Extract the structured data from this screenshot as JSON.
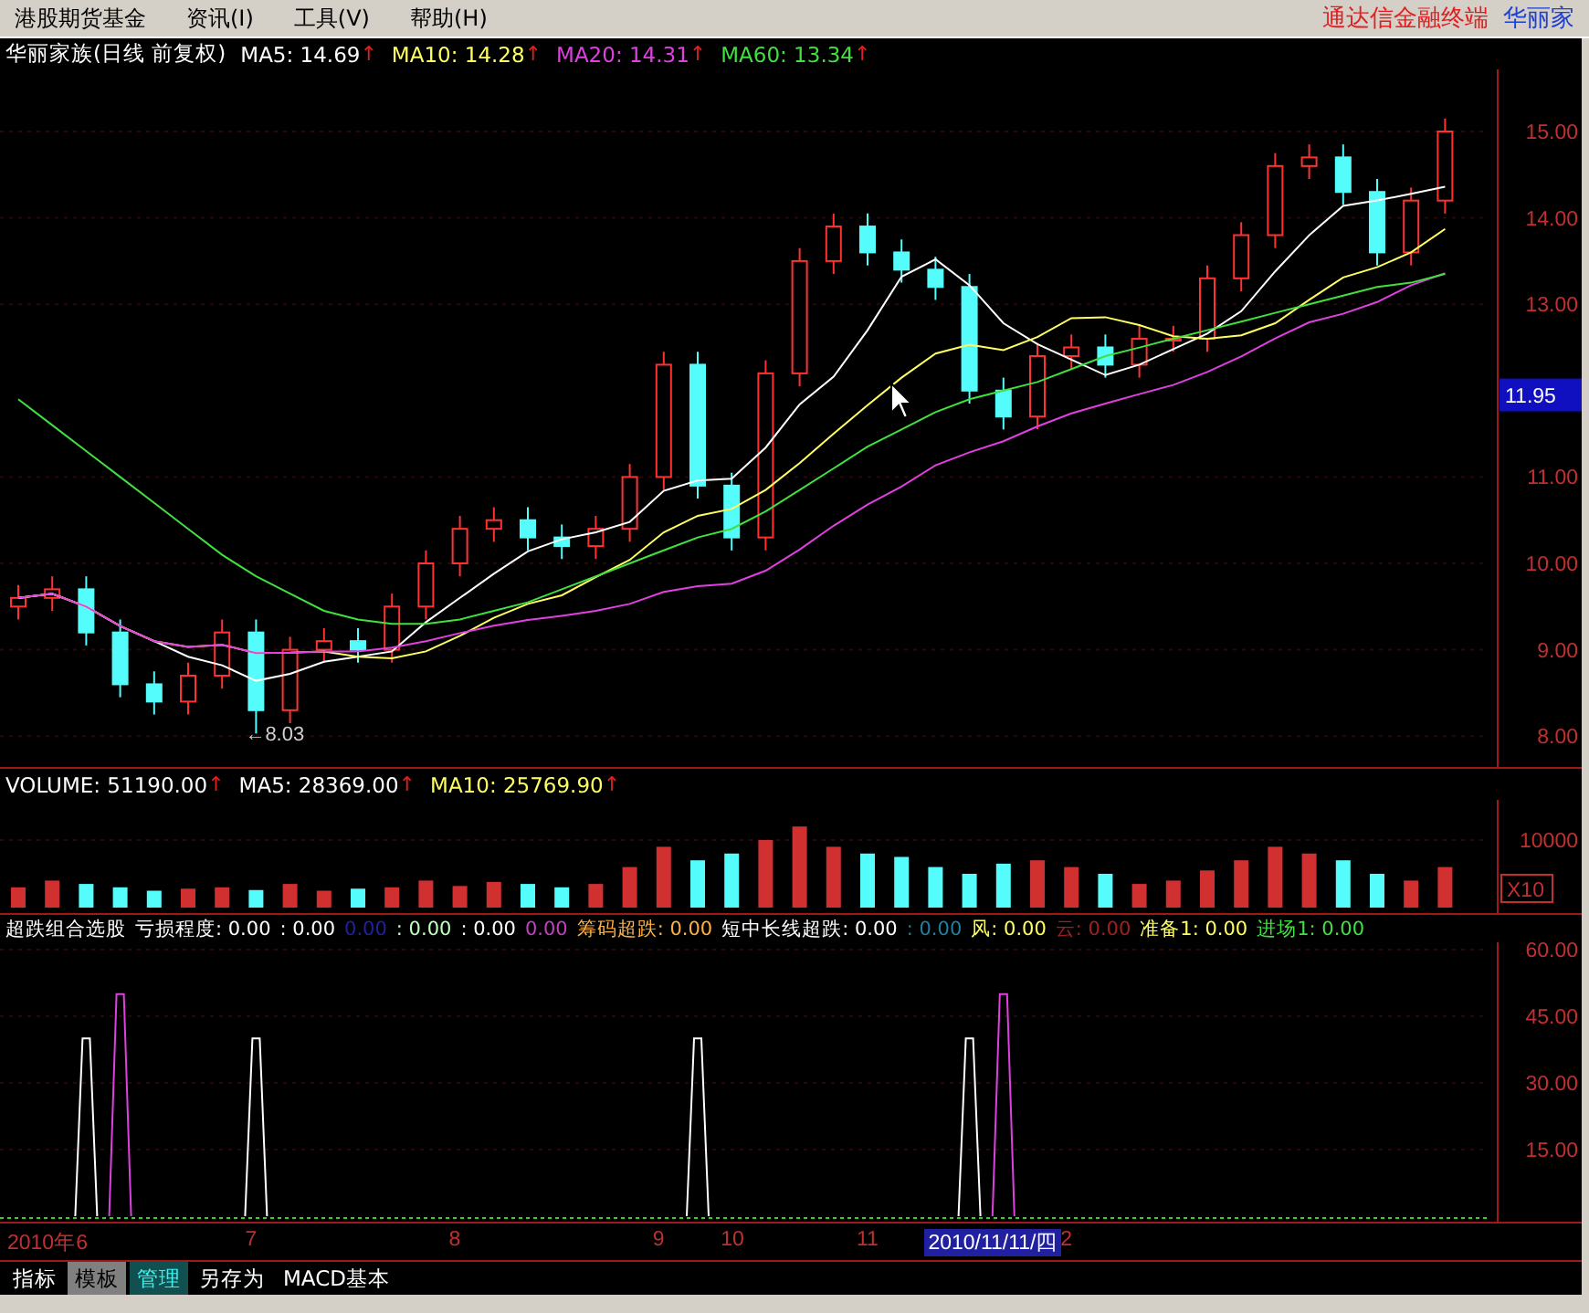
{
  "menu_bar": {
    "items": [
      "港股期货基金",
      "资讯(I)",
      "工具(V)",
      "帮助(H)"
    ],
    "title_parts": [
      {
        "text": "通达信金融终端",
        "color": "#e02020"
      },
      {
        "text": "华丽家",
        "color": "#2040d0"
      }
    ]
  },
  "price_panel": {
    "legend": [
      {
        "text": "华丽家族(日线 前复权)",
        "color": "#ffffff"
      },
      {
        "text": "MA5: 14.69",
        "color": "#ffffff",
        "arrow": "↑"
      },
      {
        "text": "MA10: 14.28",
        "color": "#ffff60",
        "arrow": "↑"
      },
      {
        "text": "MA20: 14.31",
        "color": "#e040e0",
        "arrow": "↑"
      },
      {
        "text": "MA60: 13.34",
        "color": "#40e040",
        "arrow": "↑"
      }
    ],
    "axis_labels": [
      "15.00",
      "14.00",
      "13.00",
      "11.00",
      "10.00",
      "9.00",
      "8.00"
    ],
    "cursor_price": "11.95",
    "low_label": "←8.03"
  },
  "volume_panel": {
    "legend": [
      {
        "text": "VOLUME: 51190.00",
        "color": "#ffffff",
        "arrow": "↑"
      },
      {
        "text": "MA5: 28369.00",
        "color": "#ffffff",
        "arrow": "↑"
      },
      {
        "text": "MA10: 25769.90",
        "color": "#ffff60",
        "arrow": "↑"
      }
    ],
    "axis_labels": [
      "10000"
    ],
    "unit_label": "X10"
  },
  "indicator_panel": {
    "legend": [
      {
        "text": "超跌组合选股",
        "color": "#ffffff"
      },
      {
        "text": "亏损程度: 0.00",
        "color": "#ffffff"
      },
      {
        "text": ": 0.00",
        "color": "#ffffff"
      },
      {
        "text": "0.00",
        "color": "#2020a0"
      },
      {
        "text": ": 0.00",
        "color": "#c0ffc0"
      },
      {
        "text": ": 0.00",
        "color": "#ffffff"
      },
      {
        "text": "0.00",
        "color": "#c040c0"
      },
      {
        "text": "筹码超跌: 0.00",
        "color": "#ffb040"
      },
      {
        "text": "短中长线超跌: 0.00",
        "color": "#ffffff"
      },
      {
        "text": ": 0.00",
        "color": "#2080a0"
      },
      {
        "text": "风: 0.00",
        "color": "#ffff60"
      },
      {
        "text": "云: 0.00",
        "color": "#a02020"
      },
      {
        "text": "准备1: 0.00",
        "color": "#ffff60"
      },
      {
        "text": "进场1: 0.00",
        "color": "#40e040"
      }
    ],
    "axis_labels": [
      "60.00",
      "45.00",
      "30.00",
      "15.00"
    ]
  },
  "date_axis": [
    {
      "label": "2010年6",
      "selected": false
    },
    {
      "label": "7",
      "selected": false
    },
    {
      "label": "8",
      "selected": false
    },
    {
      "label": "9",
      "selected": false
    },
    {
      "label": "10",
      "selected": false
    },
    {
      "label": "11",
      "selected": false
    },
    {
      "label": "2010/11/11/四",
      "selected": true
    },
    {
      "label": "2",
      "selected": false
    }
  ],
  "bottom_tabs": [
    {
      "label": "指标",
      "kind": "plain"
    },
    {
      "label": "模板",
      "kind": "grey"
    },
    {
      "label": "管理",
      "kind": "active"
    },
    {
      "label": "另存为",
      "kind": "plain"
    },
    {
      "label": "MACD基本",
      "kind": "plain"
    }
  ]
}
